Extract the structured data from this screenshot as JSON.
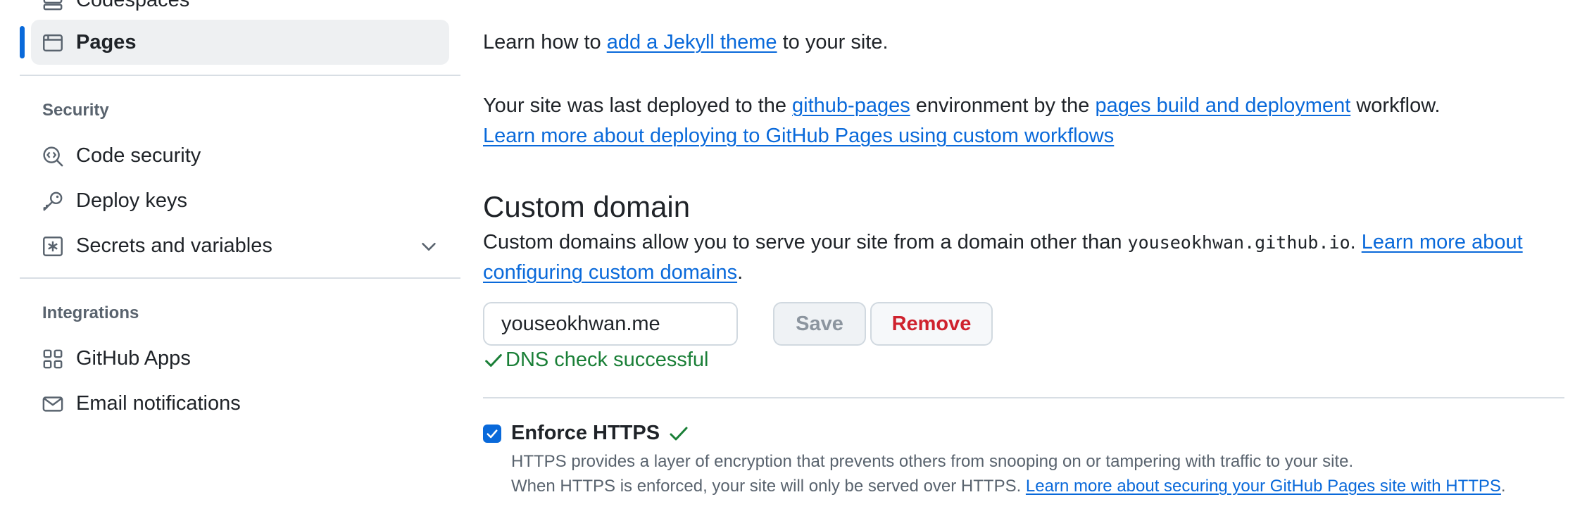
{
  "sidebar": {
    "partial_item": {
      "label": "Codespaces",
      "icon": "codespaces-icon"
    },
    "selected_item": {
      "label": "Pages",
      "icon": "browser-icon"
    },
    "security": {
      "title": "Security",
      "items": [
        {
          "label": "Code security",
          "icon": "code-security-icon"
        },
        {
          "label": "Deploy keys",
          "icon": "key-icon"
        },
        {
          "label": "Secrets and variables",
          "icon": "asterisk-box-icon"
        }
      ]
    },
    "integrations": {
      "title": "Integrations",
      "items": [
        {
          "label": "GitHub Apps",
          "icon": "apps-grid-icon"
        },
        {
          "label": "Email notifications",
          "icon": "mail-icon"
        }
      ]
    }
  },
  "main": {
    "jekyll": {
      "prefix": "Learn how to ",
      "link": "add a Jekyll theme",
      "suffix": " to your site."
    },
    "deploy": {
      "t1": "Your site was last deployed to the ",
      "link1": "github-pages",
      "t2": " environment by the ",
      "link2": "pages build and deployment",
      "t3": " workflow.",
      "learn_more": "Learn more about deploying to GitHub Pages using custom workflows"
    },
    "custom_domain": {
      "title": "Custom domain",
      "desc": "Custom domains allow you to serve your site from a domain other than ",
      "code": "youseokhwan.github.io",
      "sep": ". ",
      "link_line1": "Learn more about",
      "link_line2": "configuring custom domains",
      "end": ".",
      "input_value": "youseokhwan.me",
      "save_label": "Save",
      "remove_label": "Remove",
      "dns_status": "DNS check successful"
    },
    "https": {
      "label": "Enforce HTTPS",
      "checked": true,
      "line1": "HTTPS provides a layer of encryption that prevents others from snooping on or tampering with traffic to your site.",
      "line2": "When HTTPS is enforced, your site will only be served over HTTPS. ",
      "link": "Learn more about securing your GitHub Pages site with HTTPS",
      "end": "."
    }
  },
  "colors": {
    "accent": "#0969da",
    "success": "#1a7f37",
    "danger": "#cf222e",
    "muted": "#59636e"
  }
}
